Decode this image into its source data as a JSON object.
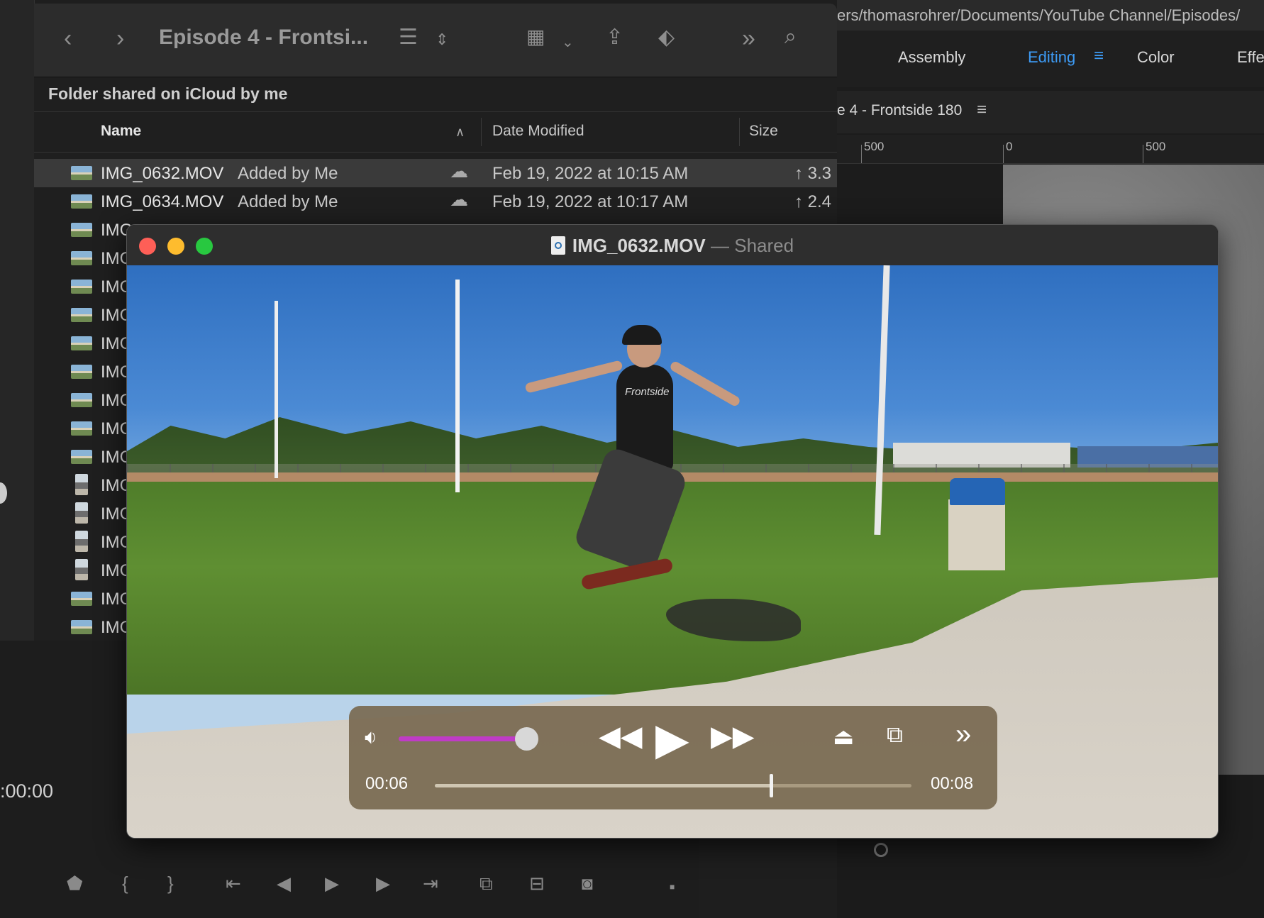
{
  "editor": {
    "path": "ers/thomasrohrer/Documents/YouTube Channel/Episodes/",
    "workspaces": [
      "Assembly",
      "Editing",
      "Color",
      "Effe"
    ],
    "sequence_title": "e 4 - Frontside 180",
    "ruler_labels": [
      "500",
      "0",
      "500"
    ],
    "timecode": ":00:00"
  },
  "finder": {
    "window_title": "Episode 4 - Frontsi...",
    "shared_header": "Folder shared on iCloud by me",
    "columns": {
      "name": "Name",
      "date": "Date Modified",
      "size": "Size"
    },
    "rows": [
      {
        "name": "IMG_0632.MOV",
        "added": "Added by Me",
        "date": "Feb 19, 2022 at 10:15 AM",
        "size": "↑ 3.3",
        "selected": true
      },
      {
        "name": "IMG_0634.MOV",
        "added": "Added by Me",
        "date": "Feb 19, 2022 at 10:17 AM",
        "size": "↑ 2.4"
      },
      {
        "name": "IMG"
      },
      {
        "name": "IMG"
      },
      {
        "name": "IMG"
      },
      {
        "name": "IMG"
      },
      {
        "name": "IMG"
      },
      {
        "name": "IMG"
      },
      {
        "name": "IMG"
      },
      {
        "name": "IMG"
      },
      {
        "name": "IMG"
      },
      {
        "name": "IMG"
      },
      {
        "name": "IMG"
      },
      {
        "name": "IMG"
      },
      {
        "name": "IMG"
      },
      {
        "name": "IMG"
      },
      {
        "name": "IMG"
      }
    ]
  },
  "player": {
    "filename": "IMG_0632.MOV",
    "separator": "—",
    "status": "Shared",
    "current_time": "00:06",
    "end_time": "00:08",
    "volume_fraction": 0.85,
    "progress_fraction": 0.705,
    "shirt_text": "Frontside"
  },
  "colors": {
    "accent": "#3d9bf5",
    "volume": "#bf3cc6",
    "close": "#fe5f57",
    "minimize": "#febc2e",
    "zoom": "#28c840"
  }
}
